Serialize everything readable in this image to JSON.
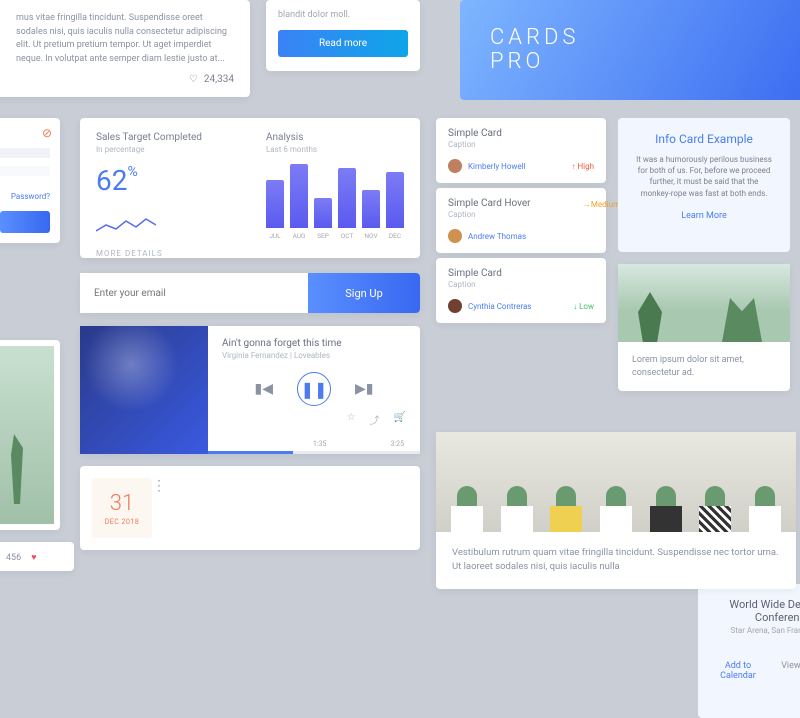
{
  "article": {
    "text": "mus vitae fringilla tincidunt. Suspendisse oreet sodales nisi, quis iaculis nulla consectetur adipiscing elit. Ut pretium pretium tempor. Ut aget imperdiet neque. In volutpat ante semper diam lestie justo at...",
    "likes": "24,334"
  },
  "readmore": {
    "desc": "blandit dolor moll.",
    "btn": "Read more"
  },
  "banner": {
    "line1": "CARDS",
    "line2": "PRO"
  },
  "login": {
    "password_link": "Password?"
  },
  "stats": {
    "target_label": "Sales Target Completed",
    "target_sub": "In percentage",
    "percent": "62",
    "more": "MORE DETAILS",
    "analysis_label": "Analysis",
    "analysis_sub": "Last 6 months",
    "months": [
      "JUL",
      "AUG",
      "SEP",
      "OCT",
      "NOV",
      "DEC"
    ],
    "bars": [
      48,
      64,
      30,
      60,
      38,
      56
    ]
  },
  "signup": {
    "placeholder": "Enter your email",
    "btn": "Sign Up"
  },
  "player": {
    "title": "Ain't gonna forget this time",
    "artist": "Virginia Fernandez | Loveables",
    "current": "1:35",
    "total": "3:25"
  },
  "event": {
    "day": "31",
    "monthyear": "DEC 2018",
    "name": "World Wide Developer Conference",
    "location": "Star Arena, San Francisco, CA",
    "add": "Add to Calendar",
    "map": "View Directions in Map"
  },
  "simple": [
    {
      "title": "Simple Card",
      "caption": "Caption",
      "user": "Kimberly Howell",
      "tag": "↑ High"
    },
    {
      "title": "Simple Card Hover",
      "caption": "Caption",
      "user": "Andrew Thomas",
      "tag": "→Medium"
    },
    {
      "title": "Simple Card",
      "caption": "Caption",
      "user": "Cynthia Contreras",
      "tag": "↓ Low"
    }
  ],
  "info": {
    "title": "Info Card Example",
    "body": "It was a humorously perilous business for both of us. For, before we proceed further, it must be said that the monkey-rope was fast at both ends.",
    "link": "Learn More"
  },
  "imgcard": {
    "text": "Lorem ipsum dolor sit amet, consectetur ad."
  },
  "likebar": {
    "count": "456"
  },
  "hero": {
    "text": "Vestibulum rutrum quam vitae fringilla tincidunt. Suspendisse nec tortor urna. Ut laoreet sodales nisi, quis iaculis nulla"
  }
}
